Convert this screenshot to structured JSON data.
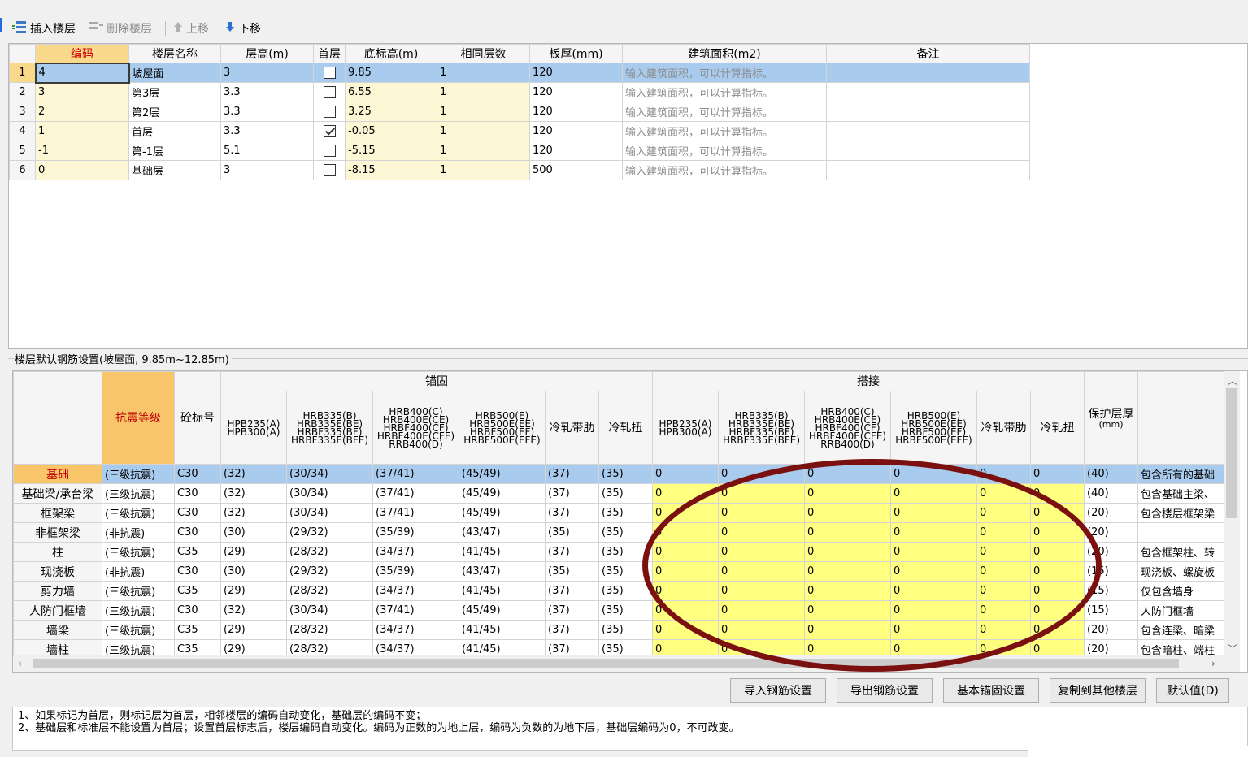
{
  "toolbar": {
    "insert_floor": "插入楼层",
    "delete_floor": "删除楼层",
    "move_up": "上移",
    "move_down": "下移"
  },
  "floor_grid": {
    "columns": [
      "编码",
      "楼层名称",
      "层高(m)",
      "首层",
      "底标高(m)",
      "相同层数",
      "板厚(mm)",
      "建筑面积(m2)",
      "备注"
    ],
    "rows": [
      {
        "num": "1",
        "code": "4",
        "name": "坡屋面",
        "height": "3",
        "first": false,
        "bottom": "9.85",
        "same": "1",
        "slab": "120",
        "area": "输入建筑面积，可以计算指标。",
        "note": ""
      },
      {
        "num": "2",
        "code": "3",
        "name": "第3层",
        "height": "3.3",
        "first": false,
        "bottom": "6.55",
        "same": "1",
        "slab": "120",
        "area": "输入建筑面积，可以计算指标。",
        "note": ""
      },
      {
        "num": "3",
        "code": "2",
        "name": "第2层",
        "height": "3.3",
        "first": false,
        "bottom": "3.25",
        "same": "1",
        "slab": "120",
        "area": "输入建筑面积，可以计算指标。",
        "note": ""
      },
      {
        "num": "4",
        "code": "1",
        "name": "首层",
        "height": "3.3",
        "first": true,
        "bottom": "-0.05",
        "same": "1",
        "slab": "120",
        "area": "输入建筑面积，可以计算指标。",
        "note": ""
      },
      {
        "num": "5",
        "code": "-1",
        "name": "第-1层",
        "height": "5.1",
        "first": false,
        "bottom": "-5.15",
        "same": "1",
        "slab": "120",
        "area": "输入建筑面积，可以计算指标。",
        "note": ""
      },
      {
        "num": "6",
        "code": "0",
        "name": "基础层",
        "height": "3",
        "first": false,
        "bottom": "-8.15",
        "same": "1",
        "slab": "500",
        "area": "输入建筑面积，可以计算指标。",
        "note": ""
      }
    ]
  },
  "rebar": {
    "title": "楼层默认钢筋设置(坡屋面, 9.85m~12.85m)",
    "group_anchor": "锚固",
    "group_lap": "搭接",
    "col_seismic": "抗震等级",
    "col_concrete": "砼标号",
    "col_cover": "保护层厚",
    "col_cover_unit": "(mm)",
    "steel_headers": [
      [
        "HPB235(A)",
        "HPB300(A)"
      ],
      [
        "HRB335(B)",
        "HRB335E(BE)",
        "HRBF335(BF)",
        "HRBF335E(BFE)"
      ],
      [
        "HRB400(C)",
        "HRB400E(CE)",
        "HRBF400(CF)",
        "HRBF400E(CFE)",
        "RRB400(D)"
      ],
      [
        "HRB500(E)",
        "HRB500E(EE)",
        "HRBF500(EF)",
        "HRBF500E(EFE)"
      ],
      [
        "冷轧带肋"
      ],
      [
        "冷轧扭"
      ]
    ],
    "rows": [
      {
        "cat": "基础",
        "seis": "(三级抗震)",
        "conc": "C30",
        "a": [
          "(32)",
          "(30/34)",
          "(37/41)",
          "(45/49)",
          "(37)",
          "(35)"
        ],
        "l": [
          "0",
          "0",
          "0",
          "0",
          "0",
          "0"
        ],
        "cover": "(40)",
        "note": "包含所有的基础"
      },
      {
        "cat": "基础梁/承台梁",
        "seis": "(三级抗震)",
        "conc": "C30",
        "a": [
          "(32)",
          "(30/34)",
          "(37/41)",
          "(45/49)",
          "(37)",
          "(35)"
        ],
        "l": [
          "0",
          "0",
          "0",
          "0",
          "0",
          "0"
        ],
        "cover": "(40)",
        "note": "包含基础主梁、"
      },
      {
        "cat": "框架梁",
        "seis": "(三级抗震)",
        "conc": "C30",
        "a": [
          "(32)",
          "(30/34)",
          "(37/41)",
          "(45/49)",
          "(37)",
          "(35)"
        ],
        "l": [
          "0",
          "0",
          "0",
          "0",
          "0",
          "0"
        ],
        "cover": "(20)",
        "note": "包含楼层框架梁"
      },
      {
        "cat": "非框架梁",
        "seis": "(非抗震)",
        "conc": "C30",
        "a": [
          "(30)",
          "(29/32)",
          "(35/39)",
          "(43/47)",
          "(35)",
          "(35)"
        ],
        "l": [
          "0",
          "0",
          "0",
          "0",
          "0",
          "0"
        ],
        "cover": "(20)",
        "note": ""
      },
      {
        "cat": "柱",
        "seis": "(三级抗震)",
        "conc": "C35",
        "a": [
          "(29)",
          "(28/32)",
          "(34/37)",
          "(41/45)",
          "(37)",
          "(35)"
        ],
        "l": [
          "0",
          "0",
          "0",
          "0",
          "0",
          "0"
        ],
        "cover": "(20)",
        "note": "包含框架柱、转"
      },
      {
        "cat": "现浇板",
        "seis": "(非抗震)",
        "conc": "C30",
        "a": [
          "(30)",
          "(29/32)",
          "(35/39)",
          "(43/47)",
          "(35)",
          "(35)"
        ],
        "l": [
          "0",
          "0",
          "0",
          "0",
          "0",
          "0"
        ],
        "cover": "(15)",
        "note": "现浇板、螺旋板"
      },
      {
        "cat": "剪力墙",
        "seis": "(三级抗震)",
        "conc": "C35",
        "a": [
          "(29)",
          "(28/32)",
          "(34/37)",
          "(41/45)",
          "(37)",
          "(35)"
        ],
        "l": [
          "0",
          "0",
          "0",
          "0",
          "0",
          "0"
        ],
        "cover": "(15)",
        "note": "仅包含墙身"
      },
      {
        "cat": "人防门框墙",
        "seis": "(三级抗震)",
        "conc": "C30",
        "a": [
          "(32)",
          "(30/34)",
          "(37/41)",
          "(45/49)",
          "(37)",
          "(35)"
        ],
        "l": [
          "0",
          "0",
          "0",
          "0",
          "0",
          "0"
        ],
        "cover": "(15)",
        "note": "人防门框墙"
      },
      {
        "cat": "墙梁",
        "seis": "(三级抗震)",
        "conc": "C35",
        "a": [
          "(29)",
          "(28/32)",
          "(34/37)",
          "(41/45)",
          "(37)",
          "(35)"
        ],
        "l": [
          "0",
          "0",
          "0",
          "0",
          "0",
          "0"
        ],
        "cover": "(20)",
        "note": "包含连梁、暗梁"
      },
      {
        "cat": "墙柱",
        "seis": "(三级抗震)",
        "conc": "C35",
        "a": [
          "(29)",
          "(28/32)",
          "(34/37)",
          "(41/45)",
          "(37)",
          "(35)"
        ],
        "l": [
          "0",
          "0",
          "0",
          "0",
          "0",
          "0"
        ],
        "cover": "(20)",
        "note": "包含暗柱、端柱"
      }
    ]
  },
  "buttons": {
    "import": "导入钢筋设置",
    "export": "导出钢筋设置",
    "basic_anchor": "基本锚固设置",
    "copy": "复制到其他楼层",
    "default": "默认值(D)"
  },
  "notes": {
    "line1": "1、如果标记为首层，则标记层为首层，相邻楼层的编码自动变化，基础层的编码不变；",
    "line2": "2、基础层和标准层不能设置为首层；设置首层标志后，楼层编码自动变化。编码为正数的为地上层，编码为负数的为地下层，基础层编码为0，不可改变。"
  },
  "colors": {
    "selected_row": "#a9cbee",
    "header_highlight": "#f9c56a",
    "lap_cells": "#ffff80",
    "annotation": "#7a1010"
  }
}
